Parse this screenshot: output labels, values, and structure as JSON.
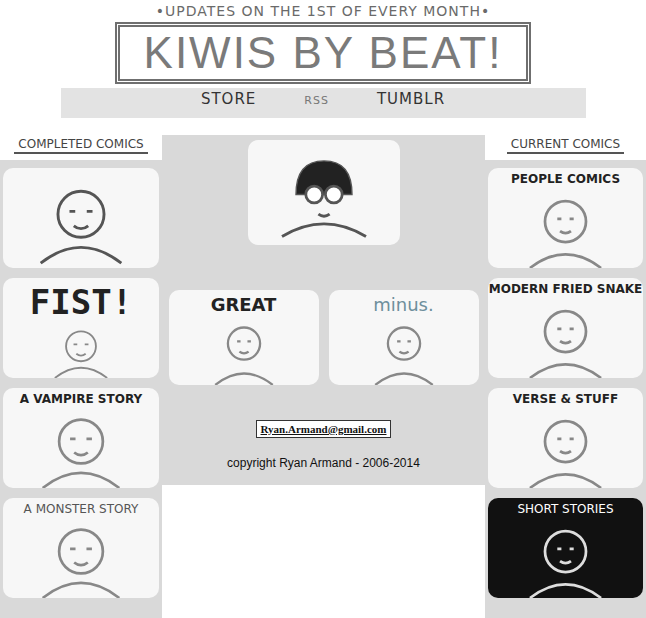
{
  "header": {
    "tagline": "•UPDATES ON THE 1ST OF EVERY MONTH•",
    "logo": "KIWIS BY BEAT!",
    "nav": [
      "STORE",
      "RSS",
      "TUMBLR"
    ]
  },
  "completed": {
    "heading": "COMPLETED COMICS",
    "items": [
      {
        "kind": "plain"
      },
      {
        "title": "FIST!",
        "kind": "titled"
      },
      {
        "title": "A VAMPIRE STORY",
        "kind": "titled"
      },
      {
        "title": "A MONSTER STORY",
        "kind": "titled"
      }
    ]
  },
  "featured": {
    "items": [
      {
        "kind": "plain"
      },
      {
        "title": "GREAT",
        "kind": "titled"
      },
      {
        "title": "minus.",
        "kind": "titled"
      }
    ]
  },
  "current": {
    "heading": "CURRENT COMICS",
    "items": [
      {
        "title": "PEOPLE COMICS",
        "kind": "titled"
      },
      {
        "title": "MODERN FRIED SNAKE",
        "kind": "titled"
      },
      {
        "title": "VERSE & STUFF",
        "kind": "titled"
      },
      {
        "title": "SHORT STORIES",
        "kind": "dark"
      }
    ]
  },
  "contact": {
    "email": "Ryan.Armand@gmail.com"
  },
  "footer": {
    "copyright": "copyright Ryan Armand - 2006-2014"
  }
}
